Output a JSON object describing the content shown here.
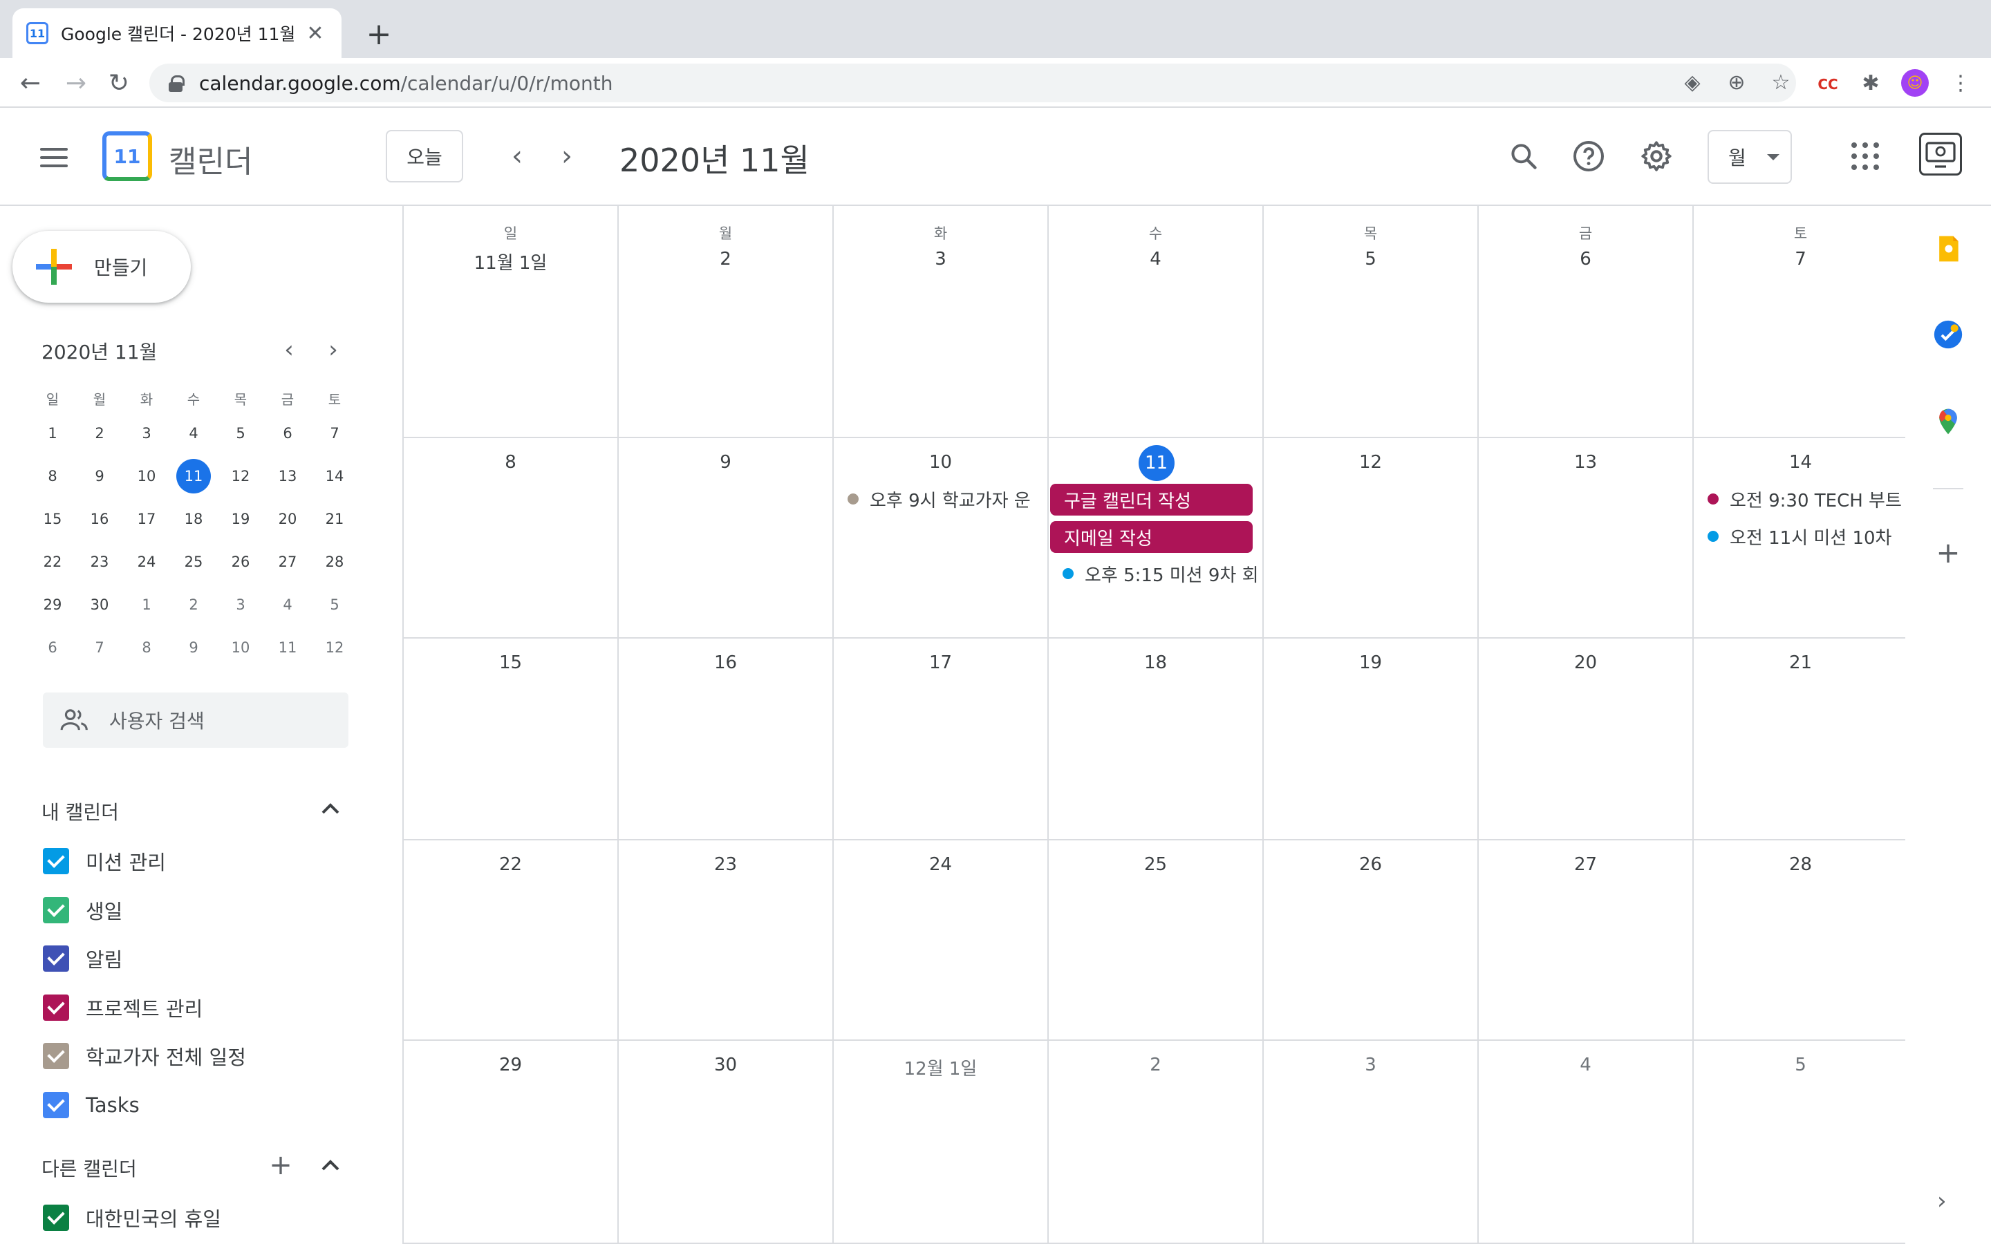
{
  "browser": {
    "tab_title": "Google 캘린더 - 2020년 11월",
    "favicon_text": "11",
    "url_host": "calendar.google.com",
    "url_path": "/calendar/u/0/r/month",
    "ext_cc_label": "CC"
  },
  "header": {
    "logo_number": "11",
    "app_name": "캘린더",
    "today_label": "오늘",
    "month_title": "2020년 11월",
    "view_label": "월"
  },
  "sidebar": {
    "create_label": "만들기",
    "mini_title": "2020년 11월",
    "mini_dow": [
      "일",
      "월",
      "화",
      "수",
      "목",
      "금",
      "토"
    ],
    "mini_weeks": [
      [
        {
          "d": "1"
        },
        {
          "d": "2"
        },
        {
          "d": "3"
        },
        {
          "d": "4"
        },
        {
          "d": "5"
        },
        {
          "d": "6"
        },
        {
          "d": "7"
        }
      ],
      [
        {
          "d": "8"
        },
        {
          "d": "9"
        },
        {
          "d": "10"
        },
        {
          "d": "11",
          "today": true
        },
        {
          "d": "12"
        },
        {
          "d": "13"
        },
        {
          "d": "14"
        }
      ],
      [
        {
          "d": "15"
        },
        {
          "d": "16"
        },
        {
          "d": "17"
        },
        {
          "d": "18"
        },
        {
          "d": "19"
        },
        {
          "d": "20"
        },
        {
          "d": "21"
        }
      ],
      [
        {
          "d": "22"
        },
        {
          "d": "23"
        },
        {
          "d": "24"
        },
        {
          "d": "25"
        },
        {
          "d": "26"
        },
        {
          "d": "27"
        },
        {
          "d": "28"
        }
      ],
      [
        {
          "d": "29"
        },
        {
          "d": "30"
        },
        {
          "d": "1",
          "other": true
        },
        {
          "d": "2",
          "other": true
        },
        {
          "d": "3",
          "other": true
        },
        {
          "d": "4",
          "other": true
        },
        {
          "d": "5",
          "other": true
        }
      ],
      [
        {
          "d": "6",
          "other": true
        },
        {
          "d": "7",
          "other": true
        },
        {
          "d": "8",
          "other": true
        },
        {
          "d": "9",
          "other": true
        },
        {
          "d": "10",
          "other": true
        },
        {
          "d": "11",
          "other": true
        },
        {
          "d": "12",
          "other": true
        }
      ]
    ],
    "people_search_placeholder": "사용자 검색",
    "my_calendars_title": "내 캘린더",
    "my_calendars": [
      {
        "name": "미션 관리",
        "color": "#039be5"
      },
      {
        "name": "생일",
        "color": "#33b679"
      },
      {
        "name": "알림",
        "color": "#3f51b5"
      },
      {
        "name": "프로젝트 관리",
        "color": "#ad1457"
      },
      {
        "name": "학교가자 전체 일정",
        "color": "#a79b8e"
      },
      {
        "name": "Tasks",
        "color": "#4285f4"
      }
    ],
    "other_calendars_title": "다른 캘린더",
    "other_calendars": [
      {
        "name": "대한민국의 휴일",
        "color": "#0b8043"
      }
    ]
  },
  "calendar": {
    "dow": [
      "일",
      "월",
      "화",
      "수",
      "목",
      "금",
      "토"
    ],
    "weeks": [
      [
        {
          "d": "11월 1일"
        },
        {
          "d": "2"
        },
        {
          "d": "3"
        },
        {
          "d": "4"
        },
        {
          "d": "5"
        },
        {
          "d": "6"
        },
        {
          "d": "7"
        }
      ],
      [
        {
          "d": "8"
        },
        {
          "d": "9"
        },
        {
          "d": "10"
        },
        {
          "d": "11",
          "today": true
        },
        {
          "d": "12"
        },
        {
          "d": "13"
        },
        {
          "d": "14"
        }
      ],
      [
        {
          "d": "15"
        },
        {
          "d": "16"
        },
        {
          "d": "17"
        },
        {
          "d": "18"
        },
        {
          "d": "19"
        },
        {
          "d": "20"
        },
        {
          "d": "21"
        }
      ],
      [
        {
          "d": "22"
        },
        {
          "d": "23"
        },
        {
          "d": "24"
        },
        {
          "d": "25"
        },
        {
          "d": "26"
        },
        {
          "d": "27"
        },
        {
          "d": "28"
        }
      ],
      [
        {
          "d": "29"
        },
        {
          "d": "30"
        },
        {
          "d": "12월 1일",
          "other": true
        },
        {
          "d": "2",
          "other": true
        },
        {
          "d": "3",
          "other": true
        },
        {
          "d": "4",
          "other": true
        },
        {
          "d": "5",
          "other": true
        }
      ]
    ],
    "events": [
      {
        "week": 1,
        "day": 2,
        "kind": "dot",
        "slot": 0,
        "color": "#a79b8e",
        "text": "오후 9시 학교가자 운"
      },
      {
        "week": 1,
        "day": 3,
        "kind": "block",
        "slot": 0,
        "color": "#ad1457",
        "text": "구글 캘린더 작성"
      },
      {
        "week": 1,
        "day": 3,
        "kind": "block",
        "slot": 1,
        "color": "#ad1457",
        "text": "지메일 작성"
      },
      {
        "week": 1,
        "day": 3,
        "kind": "dot",
        "slot": 2,
        "color": "#039be5",
        "text": "오후 5:15 미션 9차 회"
      },
      {
        "week": 1,
        "day": 6,
        "kind": "dot",
        "slot": 0,
        "color": "#ad1457",
        "text": "오전 9:30 TECH 부트"
      },
      {
        "week": 1,
        "day": 6,
        "kind": "dot",
        "slot": 1,
        "color": "#039be5",
        "text": "오전 11시 미션 10차"
      }
    ]
  }
}
